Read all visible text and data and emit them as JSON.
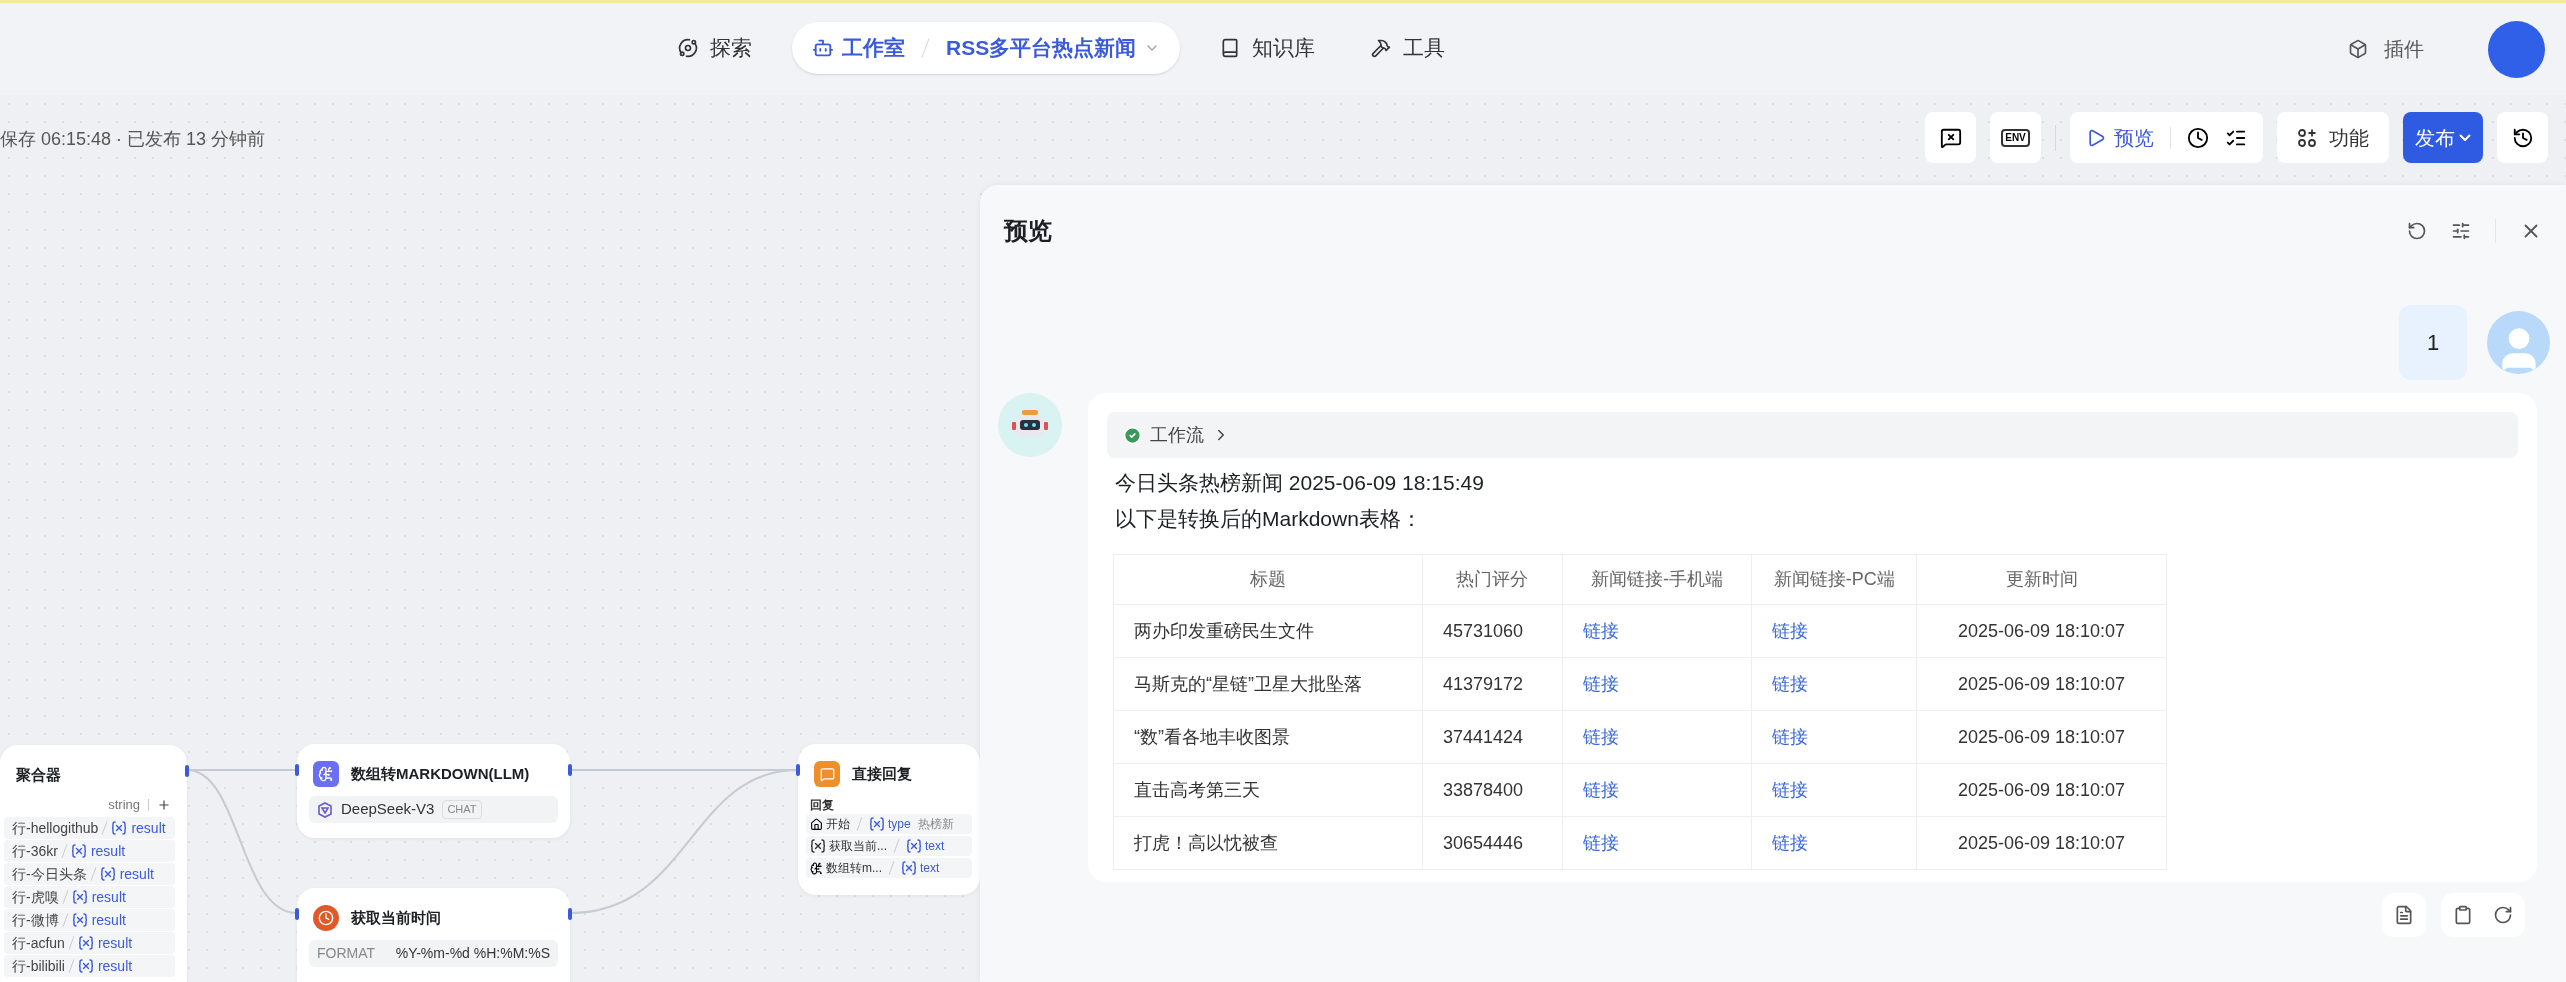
{
  "nav": [
    {
      "kind": "link",
      "label": "探索",
      "selected": false
    },
    {
      "kind": "breadcrumb",
      "label": "工作室",
      "project": "RSS多平台热点新闻",
      "selected": true
    },
    {
      "kind": "link",
      "label": "知识库",
      "selected": false
    },
    {
      "kind": "link",
      "label": "工具",
      "selected": false
    }
  ],
  "plugins": "插件",
  "toolbar": {
    "status": "保存 06:15:48 · 已发布 13 分钟前",
    "env": "ENV",
    "preview": "预览",
    "features": "功能",
    "publish": "发布"
  },
  "canvas": {
    "aggregator": {
      "title": "聚合器",
      "type": "string",
      "rows": [
        {
          "source": "行-hellogithub",
          "var": "result"
        },
        {
          "source": "行-36kr",
          "var": "result"
        },
        {
          "source": "行-今日头条",
          "var": "result"
        },
        {
          "source": "行-虎嗅",
          "var": "result"
        },
        {
          "source": "行-微博",
          "var": "result"
        },
        {
          "source": "行-acfun",
          "var": "result"
        },
        {
          "source": "行-bilibili",
          "var": "result"
        }
      ]
    },
    "llm": {
      "title": "数组转MARKDOWN(LLM)",
      "model": "DeepSeek-V3",
      "tag": "CHAT"
    },
    "time": {
      "title": "获取当前时间",
      "params": [
        {
          "key": "FORMAT",
          "value": "%Y-%m-%d %H:%M:%S"
        }
      ]
    },
    "reply": {
      "title": "直接回复",
      "label": "回复",
      "rows": [
        {
          "source": "开始",
          "var": "type",
          "value": "热榜新"
        },
        {
          "source": "获取当前...",
          "var": "text"
        },
        {
          "source": "数组转m...",
          "var": "text"
        }
      ]
    }
  },
  "preview": {
    "title": "预览",
    "user_message": "1",
    "bot": {
      "workflow": "工作流",
      "lines": [
        "今日头条热榜新闻 2025-06-09 18:15:49",
        "以下是转换后的Markdown表格："
      ],
      "table": {
        "columns": [
          "标题",
          "热门评分",
          "新闻链接-手机端",
          "新闻链接-PC端",
          "更新时间"
        ],
        "rows": [
          {
            "title": "两办印发重磅民生文件",
            "score": "45731060",
            "mobile": "链接",
            "pc": "链接",
            "updated": "2025-06-09 18:10:07"
          },
          {
            "title": "马斯克的“星链”卫星大批坠落",
            "score": "41379172",
            "mobile": "链接",
            "pc": "链接",
            "updated": "2025-06-09 18:10:07"
          },
          {
            "title": "“数”看各地丰收图景",
            "score": "37441424",
            "mobile": "链接",
            "pc": "链接",
            "updated": "2025-06-09 18:10:07"
          },
          {
            "title": "直击高考第三天",
            "score": "33878400",
            "mobile": "链接",
            "pc": "链接",
            "updated": "2025-06-09 18:10:07"
          },
          {
            "title": "打虎！高以忱被查",
            "score": "30654446",
            "mobile": "链接",
            "pc": "链接",
            "updated": "2025-06-09 18:10:07"
          }
        ]
      }
    }
  }
}
